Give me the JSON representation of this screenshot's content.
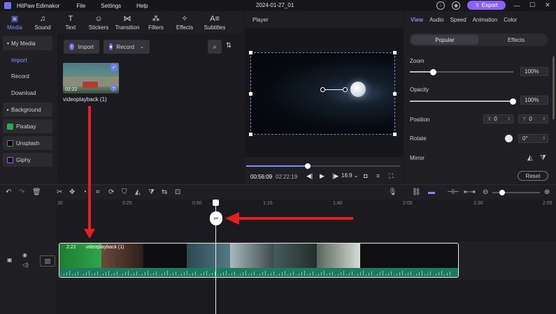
{
  "titlebar": {
    "app_name": "HitPaw Edimakor",
    "menu": [
      "File",
      "Settings",
      "Help"
    ],
    "project_title": "2024-01-27_01",
    "export_label": "Export"
  },
  "tool_tabs": [
    {
      "label": "Media",
      "icon": "media-icon"
    },
    {
      "label": "Sound",
      "icon": "music-note-icon"
    },
    {
      "label": "Text",
      "icon": "text-icon"
    },
    {
      "label": "Stickers",
      "icon": "sticker-icon"
    },
    {
      "label": "Transition",
      "icon": "transition-icon"
    },
    {
      "label": "Filters",
      "icon": "filters-icon"
    },
    {
      "label": "Effects",
      "icon": "effects-icon"
    },
    {
      "label": "Subtitles",
      "icon": "subtitles-icon"
    }
  ],
  "sidebar": {
    "items": [
      {
        "label": "My Media"
      },
      {
        "label": "Import"
      },
      {
        "label": "Record"
      },
      {
        "label": "Download"
      },
      {
        "label": "Background"
      },
      {
        "label": "Pixabay"
      },
      {
        "label": "Unsplash"
      },
      {
        "label": "Giphy"
      }
    ]
  },
  "media": {
    "import_label": "Import",
    "record_label": "Record",
    "thumb_duration": "02:22",
    "thumb_name": "videoplayback (1)"
  },
  "player": {
    "title": "Player",
    "progress": 0.4,
    "time_current": "00:56:09",
    "time_total": "02:22:19",
    "aspect": "16:9"
  },
  "props": {
    "tabs": [
      "View",
      "Audio",
      "Speed",
      "Animation",
      "Color"
    ],
    "seg_popular": "Popular",
    "seg_effects": "Effects",
    "zoom_label": "Zoom",
    "zoom_value": "100%",
    "zoom_level": 0.22,
    "opacity_label": "Opacity",
    "opacity_value": "100%",
    "opacity_level": 1.0,
    "position_label": "Position",
    "pos_x_prefix": "X",
    "pos_x": "0",
    "pos_y_prefix": "Y",
    "pos_y": "0",
    "rotate_label": "Rotate",
    "rotate_value": "0°",
    "mirror_label": "Mirror",
    "reset_label": "Reset"
  },
  "timeline": {
    "ruler": [
      "30",
      "0:25",
      "0:50",
      "1:15",
      "1:40",
      "2:05",
      "2:30",
      "2:55"
    ],
    "clip_duration": "2:22",
    "clip_name": "videoplayback (1)"
  },
  "colors": {
    "accent": "#7d8cff",
    "export": "#8a63f5",
    "audio_track": "#1e7a5f",
    "annotation_arrow": "#e51e1e"
  }
}
